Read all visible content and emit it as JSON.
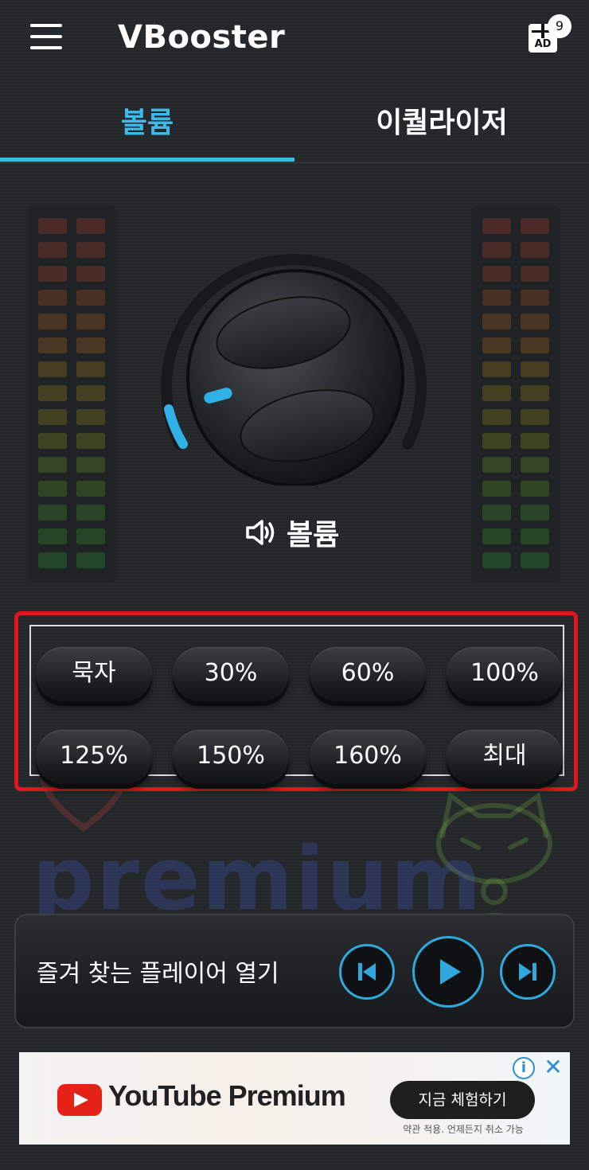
{
  "app": {
    "title": "VBooster",
    "ad_badge_count": "9",
    "ad_icon_text": "AD"
  },
  "tabs": [
    {
      "label": "볼륨",
      "active": true
    },
    {
      "label": "이퀄라이저",
      "active": false
    }
  ],
  "knob": {
    "label": "볼륨",
    "level_fraction": 0.05
  },
  "presets": [
    "묵자",
    "30%",
    "60%",
    "100%",
    "125%",
    "150%",
    "160%",
    "최대"
  ],
  "player": {
    "open_label": "즐겨 찾는 플레이어 열기"
  },
  "ad": {
    "brand": "YouTube Premium",
    "cta": "지금 체험하기",
    "fine_print": "약관 적용. 언제든지 취소 가능",
    "info_symbol": "i",
    "close_symbol": "✕"
  },
  "watermark": {
    "text": "premium"
  },
  "colors": {
    "accent": "#3fb8ea",
    "highlight_frame": "#e0161f",
    "background": "#25282b"
  }
}
